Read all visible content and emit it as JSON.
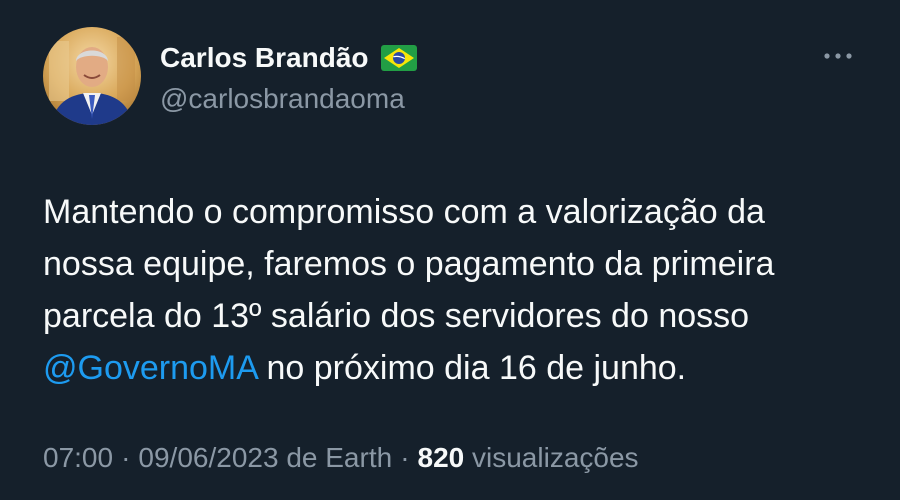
{
  "author": {
    "display_name": "Carlos Brandão",
    "handle": "@carlosbrandaoma",
    "flag_icon": "brazil-flag-icon"
  },
  "actions": {
    "more_icon": "more-horizontal-icon"
  },
  "tweet": {
    "lines": [
      "Mantendo o compromisso com a valorização da",
      "nossa equipe, faremos o pagamento da primeira",
      "parcela do 13º salário dos servidores do nosso"
    ],
    "mention": "@GovernoMA",
    "last_line_rest": " no próximo dia 16 de junho."
  },
  "meta": {
    "time": "07:00",
    "separator": "·",
    "date": "09/06/2023",
    "source": "de Earth",
    "views_count": "820",
    "views_label": "visualizações"
  },
  "colors": {
    "background": "#15202b",
    "text_primary": "#f7f9f9",
    "text_secondary": "#8b98a5",
    "link": "#1d9bf0"
  }
}
